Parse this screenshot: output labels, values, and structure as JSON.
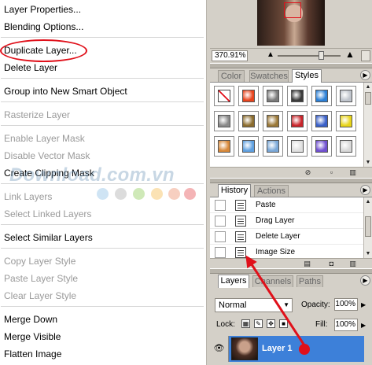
{
  "context_menu": {
    "items": [
      {
        "label": "Layer Properties...",
        "enabled": true
      },
      {
        "label": "Blending Options...",
        "enabled": true
      },
      {
        "label": "Duplicate Layer...",
        "enabled": true,
        "highlighted": true
      },
      {
        "label": "Delete Layer",
        "enabled": true
      },
      {
        "label": "Group into New Smart Object",
        "enabled": true
      },
      {
        "label": "Rasterize Layer",
        "enabled": false
      },
      {
        "label": "Enable Layer Mask",
        "enabled": false
      },
      {
        "label": "Disable Vector Mask",
        "enabled": false
      },
      {
        "label": "Create Clipping Mask",
        "enabled": true
      },
      {
        "label": "Link Layers",
        "enabled": false
      },
      {
        "label": "Select Linked Layers",
        "enabled": false
      },
      {
        "label": "Select Similar Layers",
        "enabled": true
      },
      {
        "label": "Copy Layer Style",
        "enabled": false
      },
      {
        "label": "Paste Layer Style",
        "enabled": false
      },
      {
        "label": "Clear Layer Style",
        "enabled": false
      },
      {
        "label": "Merge Down",
        "enabled": true
      },
      {
        "label": "Merge Visible",
        "enabled": true
      },
      {
        "label": "Flatten Image",
        "enabled": true
      }
    ]
  },
  "watermark": {
    "text": "Download.com.vn",
    "dot_colors": [
      "#cfe4f4",
      "#dcdcdc",
      "#cfe9b8",
      "#fbe2b4",
      "#f7cfc0",
      "#f4b4b6"
    ]
  },
  "navigator": {
    "zoom": "370.91%"
  },
  "styles_palette": {
    "tabs": [
      "Color",
      "Swatches",
      "Styles"
    ],
    "active_tab": "Styles",
    "swatch_colors": [
      "none",
      "#e8431c",
      "#7a7a7a",
      "#3a3a3a",
      "#2b7fd6",
      "#bfc4cc",
      "#8a8a8a",
      "#8b6c2e",
      "#9a7838",
      "#c8242a",
      "#3a60c8",
      "#e8d418",
      "#d8893a",
      "#5fa0e0",
      "#7aa8d8",
      "#e0e0e0",
      "#7050d0",
      "#d8d8d8"
    ]
  },
  "history_palette": {
    "tabs": [
      "History",
      "Actions"
    ],
    "active_tab": "History",
    "items": [
      "Paste",
      "Drag Layer",
      "Delete Layer",
      "Image Size"
    ]
  },
  "layers_palette": {
    "tabs": [
      "Layers",
      "Channels",
      "Paths"
    ],
    "active_tab": "Layers",
    "blend_mode": "Normal",
    "opacity_label": "Opacity:",
    "opacity_value": "100%",
    "lock_label": "Lock:",
    "fill_label": "Fill:",
    "fill_value": "100%",
    "layer_name": "Layer 1"
  },
  "colors": {
    "annotation_red": "#e0101a",
    "selection_blue": "#3d80d9"
  }
}
